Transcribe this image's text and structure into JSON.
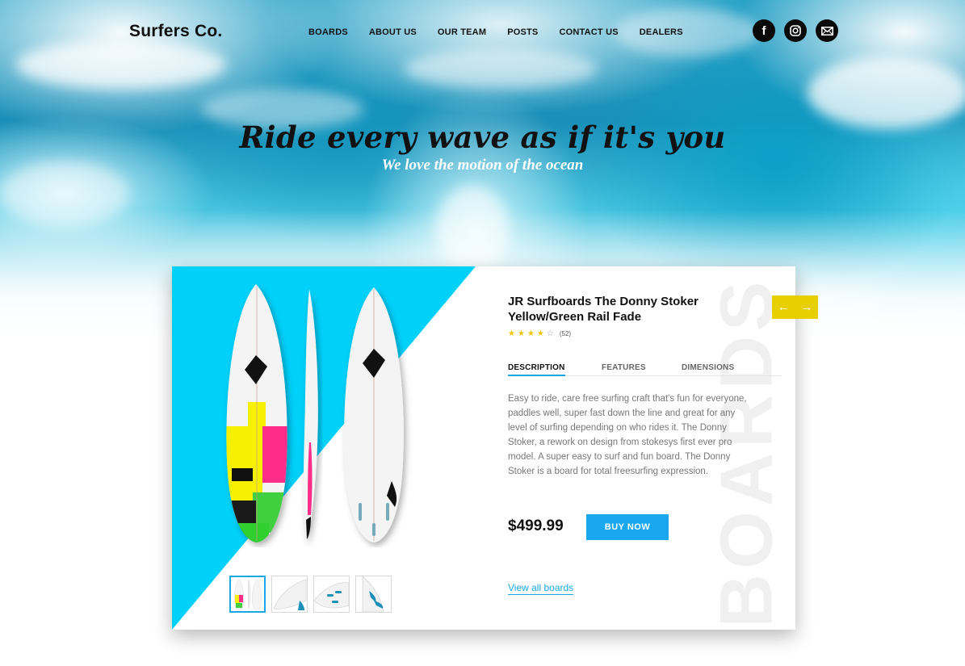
{
  "brand": {
    "name": "Surfers Co."
  },
  "nav": {
    "items": [
      {
        "label": "BOARDS"
      },
      {
        "label": "ABOUT US"
      },
      {
        "label": "OUR TEAM"
      },
      {
        "label": "POSTS"
      },
      {
        "label": "CONTACT US"
      },
      {
        "label": "DEALERS"
      }
    ]
  },
  "socials": [
    {
      "icon": "facebook-icon",
      "glyph": "f"
    },
    {
      "icon": "instagram-icon"
    },
    {
      "icon": "mail-icon"
    }
  ],
  "hero": {
    "headline": "Ride every wave as if it's you",
    "subline": "We love the motion of the ocean"
  },
  "product": {
    "title": "JR Surfboards The Donny Stoker Yellow/Green Rail Fade",
    "rating": {
      "stars": 4,
      "max": 5,
      "count": "(52)"
    },
    "tabs": [
      {
        "label": "DESCRIPTION",
        "active": true
      },
      {
        "label": "FEATURES",
        "active": false
      },
      {
        "label": "DIMENSIONS",
        "active": false
      }
    ],
    "description": "Easy to ride, care free surfing craft that's fun for everyone, paddles well, super fast down the line and great for any level of surfing depending on who rides it. The Donny Stoker, a rework on design from stokesys first ever pro model. A super easy to surf and fun board. The Donny Stoker is a board for total freesurfing expression.",
    "price": "$499.99",
    "buy_label": "BUY NOW",
    "view_all_label": "View all boards",
    "watermark": "BOARDS",
    "thumbnails": 4
  },
  "carousel": {
    "prev": "←",
    "next": "→"
  },
  "colors": {
    "accent_blue": "#1aa7f0",
    "card_cyan": "#00d1fb",
    "arrow_yellow": "#e8d000",
    "star_yellow": "#f2c500"
  }
}
